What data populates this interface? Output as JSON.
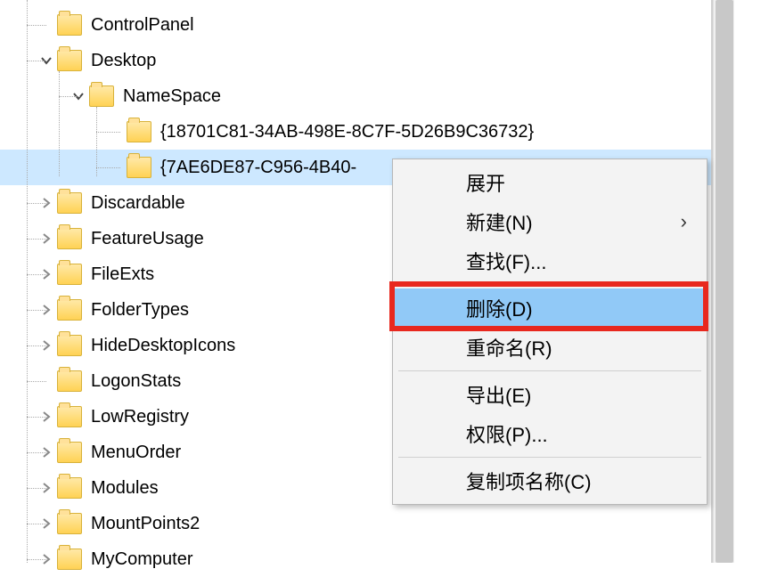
{
  "tree": {
    "items": [
      {
        "label": "ControlPanel",
        "toggle": "blank",
        "indent": 1,
        "selected": false
      },
      {
        "label": "Desktop",
        "toggle": "open",
        "indent": 1,
        "selected": false
      },
      {
        "label": "NameSpace",
        "toggle": "open",
        "indent": 2,
        "selected": false
      },
      {
        "label": "{18701C81-34AB-498E-8C7F-5D26B9C36732}",
        "toggle": "blank",
        "indent": 3,
        "selected": false
      },
      {
        "label": "{7AE6DE87-C956-4B40-",
        "toggle": "blank",
        "indent": 3,
        "selected": true
      },
      {
        "label": "Discardable",
        "toggle": "closed",
        "indent": 1,
        "selected": false
      },
      {
        "label": "FeatureUsage",
        "toggle": "closed",
        "indent": 1,
        "selected": false
      },
      {
        "label": "FileExts",
        "toggle": "closed",
        "indent": 1,
        "selected": false
      },
      {
        "label": "FolderTypes",
        "toggle": "closed",
        "indent": 1,
        "selected": false
      },
      {
        "label": "HideDesktopIcons",
        "toggle": "closed",
        "indent": 1,
        "selected": false
      },
      {
        "label": "LogonStats",
        "toggle": "blank",
        "indent": 1,
        "selected": false
      },
      {
        "label": "LowRegistry",
        "toggle": "closed",
        "indent": 1,
        "selected": false
      },
      {
        "label": "MenuOrder",
        "toggle": "closed",
        "indent": 1,
        "selected": false
      },
      {
        "label": "Modules",
        "toggle": "closed",
        "indent": 1,
        "selected": false
      },
      {
        "label": "MountPoints2",
        "toggle": "closed",
        "indent": 1,
        "selected": false
      },
      {
        "label": "MyComputer",
        "toggle": "closed",
        "indent": 1,
        "selected": false
      }
    ]
  },
  "contextMenu": {
    "items": [
      {
        "label": "展开",
        "type": "disabled",
        "hasArrow": false
      },
      {
        "label": "新建(N)",
        "type": "normal",
        "hasArrow": true
      },
      {
        "label": "查找(F)...",
        "type": "normal",
        "hasArrow": false
      },
      {
        "type": "sep"
      },
      {
        "label": "删除(D)",
        "type": "highlight",
        "hasArrow": false
      },
      {
        "label": "重命名(R)",
        "type": "normal",
        "hasArrow": false
      },
      {
        "type": "sep"
      },
      {
        "label": "导出(E)",
        "type": "normal",
        "hasArrow": false
      },
      {
        "label": "权限(P)...",
        "type": "normal",
        "hasArrow": false
      },
      {
        "type": "sep"
      },
      {
        "label": "复制项名称(C)",
        "type": "normal",
        "hasArrow": false
      }
    ],
    "submenuArrow": "›"
  }
}
